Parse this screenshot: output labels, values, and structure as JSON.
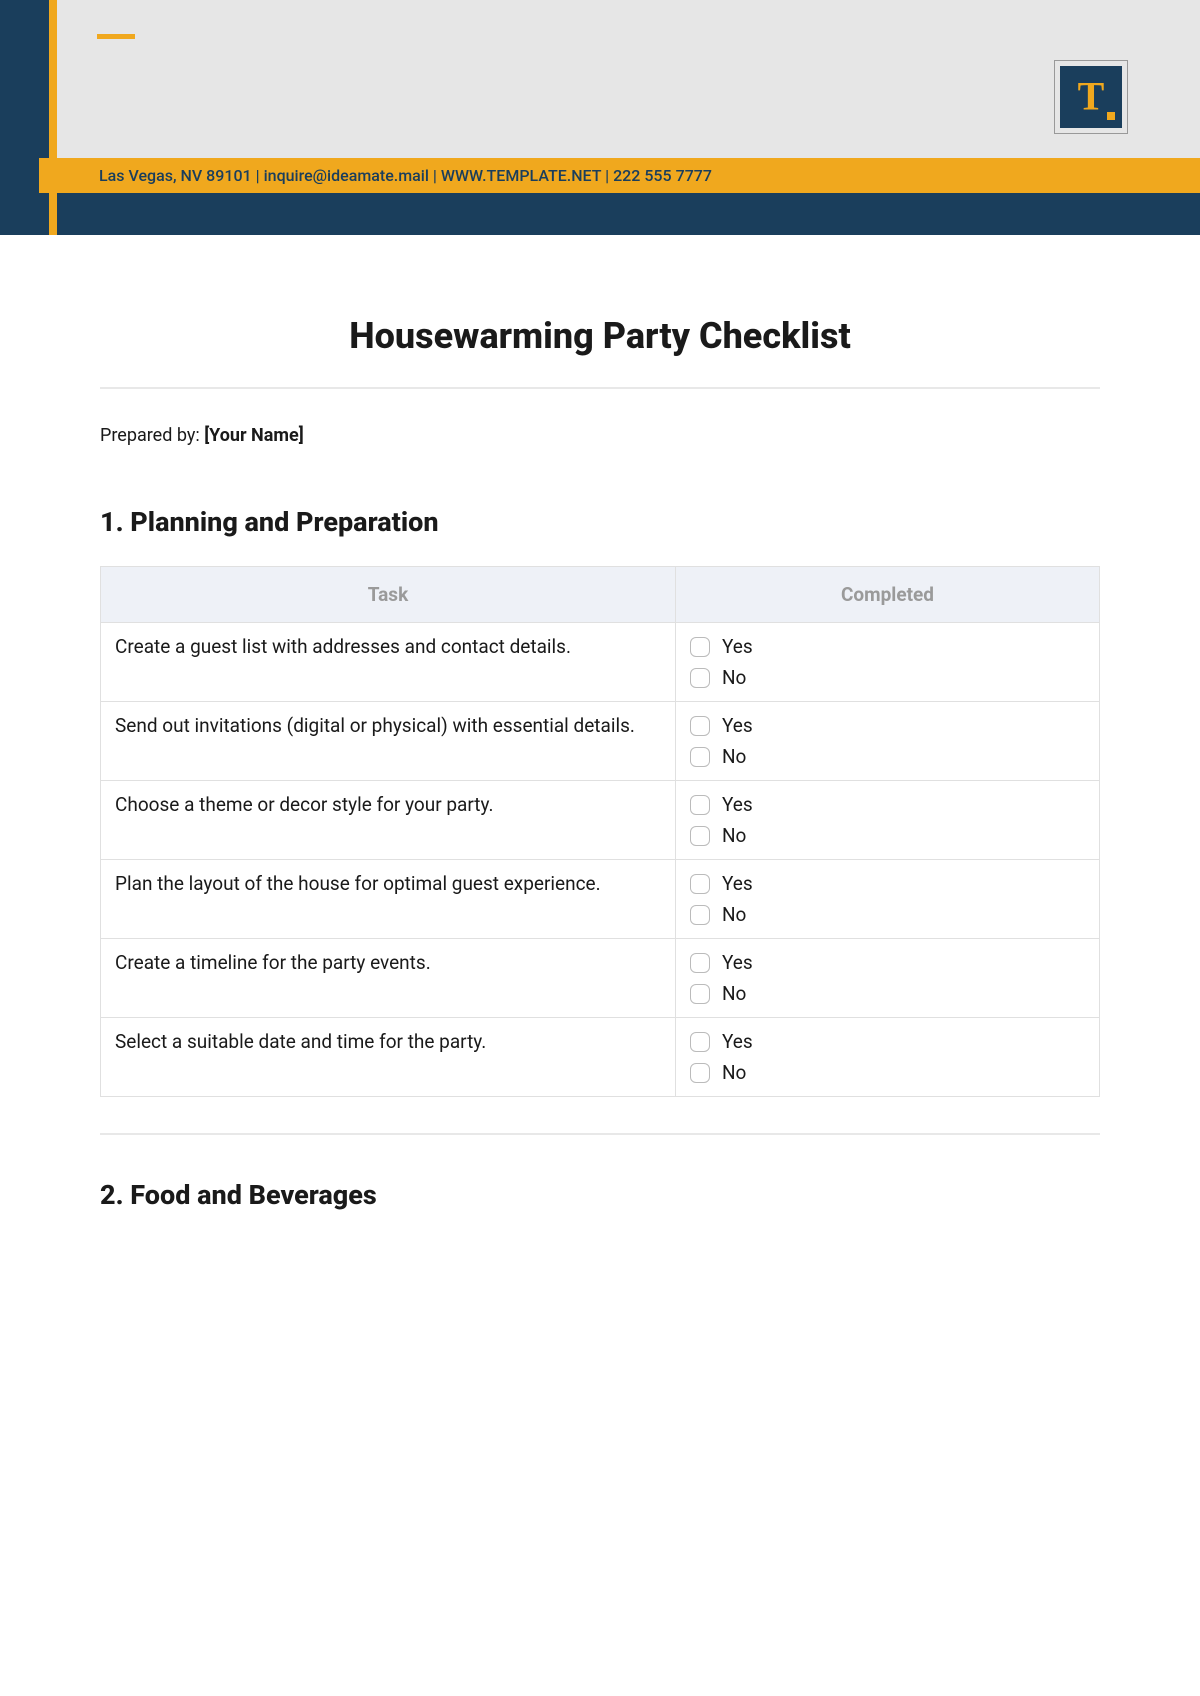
{
  "logo": {
    "letter": "T"
  },
  "banner": {
    "address": "Las Vegas, NV 89101",
    "email": "inquire@ideamate.mail",
    "website": "WWW.TEMPLATE.NET",
    "phone": "222 555 7777"
  },
  "title": "Housewarming Party Checklist",
  "prepared": {
    "label": "Prepared by: ",
    "value": "[Your Name]"
  },
  "columns": {
    "task": "Task",
    "completed": "Completed"
  },
  "options": {
    "yes": "Yes",
    "no": "No"
  },
  "section1": {
    "heading": "1. Planning and Preparation",
    "rows": [
      "Create a guest list with addresses and contact details.",
      "Send out invitations (digital or physical) with essential details.",
      "Choose a theme or decor style for your party.",
      "Plan the layout of the house for optimal guest experience.",
      "Create a timeline for the party events.",
      "Select a suitable date and time for the party."
    ]
  },
  "section2": {
    "heading": "2. Food and Beverages"
  }
}
